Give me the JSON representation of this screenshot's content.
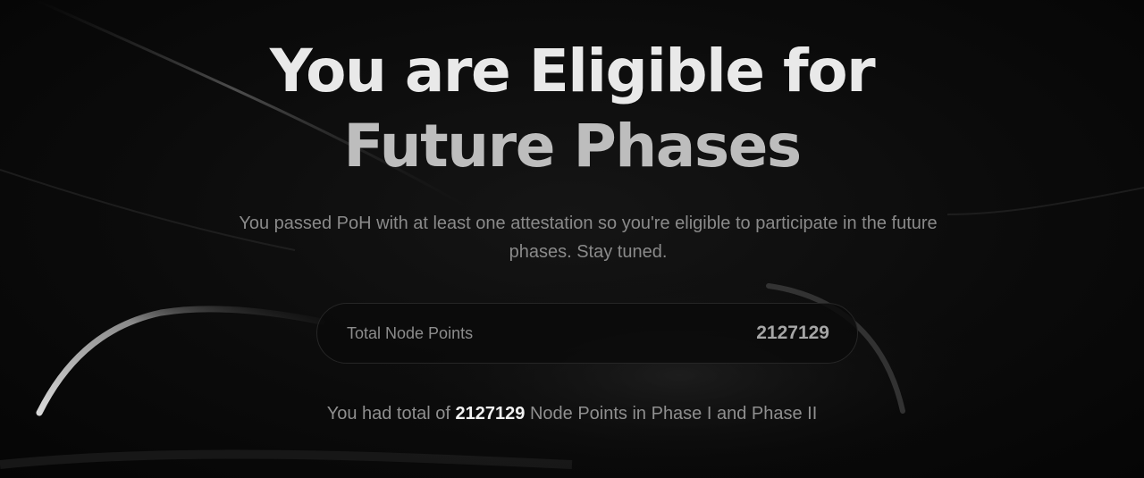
{
  "hero": {
    "title_line1": "You are Eligible for",
    "title_line2": "Future Phases",
    "subtitle": "You passed PoH with at least one attestation so you're eligible to participate in the future phases. Stay tuned."
  },
  "points_card": {
    "label": "Total Node Points",
    "value": "2127129"
  },
  "summary": {
    "prefix": "You had total of ",
    "points": "2127129",
    "suffix": " Node Points in Phase I and Phase II"
  },
  "colors": {
    "background": "#070707",
    "title_primary": "#e9e9e9",
    "title_secondary": "#bdbdbd",
    "muted_text": "#8a8a8a",
    "highlight_text": "#f2f2f2"
  }
}
